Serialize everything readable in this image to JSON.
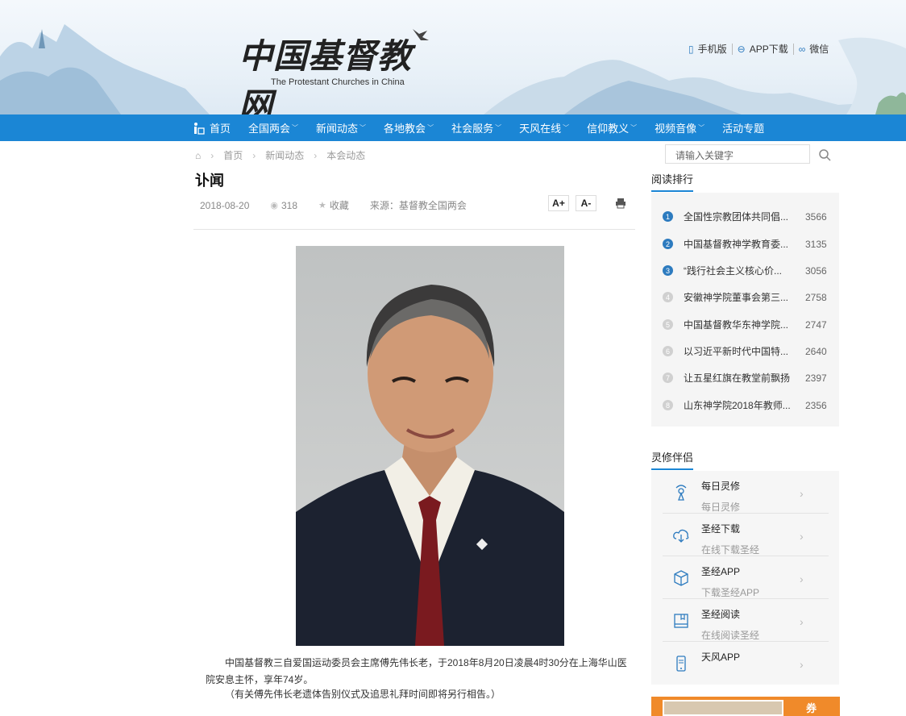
{
  "header": {
    "logo_cn": "中国基督教网",
    "logo_en": "The Protestant Churches in China",
    "links": [
      {
        "icon": "mobile-icon",
        "label": "手机版"
      },
      {
        "icon": "app-download-icon",
        "label": "APP下载"
      },
      {
        "icon": "wechat-icon",
        "label": "微信"
      }
    ]
  },
  "nav": {
    "items": [
      "首页",
      "全国两会",
      "新闻动态",
      "各地教会",
      "社会服务",
      "天风在线",
      "信仰教义",
      "视频音像",
      "活动专题"
    ]
  },
  "breadcrumb": [
    "首页",
    "新闻动态",
    "本会动态"
  ],
  "article": {
    "title": "讣闻",
    "date": "2018-08-20",
    "views": "318",
    "favorite": "收藏",
    "source": "来源：基督教全国两会",
    "font_up": "A+",
    "font_down": "A-",
    "para1": "中国基督教三自爱国运动委员会主席傅先伟长老，于2018年8月20日凌晨4时30分在上海华山医院安息主怀，享年74岁。",
    "para2": "（有关傅先伟长老遗体告别仪式及追思礼拜时间即将另行相告。）"
  },
  "sidebar": {
    "search_placeholder": "请输入关键字",
    "ranking_title": "阅读排行",
    "ranking": [
      {
        "num": "1",
        "title": "全国性宗教团体共同倡...",
        "count": "3566"
      },
      {
        "num": "2",
        "title": "中国基督教神学教育委...",
        "count": "3135"
      },
      {
        "num": "3",
        "title": "“践行社会主义核心价...",
        "count": "3056"
      },
      {
        "num": "4",
        "title": "安徽神学院董事会第三...",
        "count": "2758"
      },
      {
        "num": "5",
        "title": "中国基督教华东神学院...",
        "count": "2747"
      },
      {
        "num": "6",
        "title": "以习近平新时代中国特...",
        "count": "2640"
      },
      {
        "num": "7",
        "title": "让五星红旗在教堂前飘扬",
        "count": "2397"
      },
      {
        "num": "8",
        "title": "山东神学院2018年教师...",
        "count": "2356"
      }
    ],
    "spiritual_title": "灵修伴侣",
    "spiritual": [
      {
        "icon": "daily-devotion-icon",
        "title": "每日灵修",
        "subtitle": "每日灵修"
      },
      {
        "icon": "download-cloud-icon",
        "title": "圣经下载",
        "subtitle": "在线下载圣经"
      },
      {
        "icon": "cube-icon",
        "title": "圣经APP",
        "subtitle": "下载圣经APP"
      },
      {
        "icon": "book-icon",
        "title": "圣经阅读",
        "subtitle": "在线阅读圣经"
      },
      {
        "icon": "phone-icon",
        "title": "天风APP",
        "subtitle": ""
      }
    ],
    "ad_text": "券"
  },
  "colors": {
    "nav_blue": "#1b86d5",
    "rank_active": "#2d7bbf",
    "rank_inactive": "#d0d0d0"
  }
}
